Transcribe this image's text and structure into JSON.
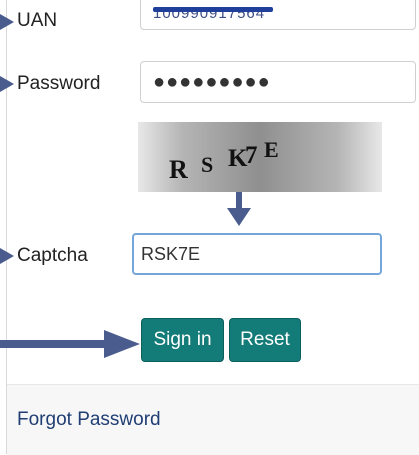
{
  "form": {
    "uan_label": "UAN",
    "uan_value": "100990917564",
    "password_label": "Password",
    "password_value": "●●●●●●●●●",
    "captcha_label": "Captcha",
    "captcha_value": "RSK7E"
  },
  "captcha_image": {
    "chars": [
      "R",
      "S",
      "K",
      "7",
      "E"
    ]
  },
  "buttons": {
    "signin_label": "Sign in",
    "reset_label": "Reset"
  },
  "links": {
    "forgot_password": "Forgot Password"
  },
  "colors": {
    "button_bg": "#137b78",
    "annotation_arrow": "#4a5c8d",
    "captcha_border": "#74a6db",
    "link": "#203e74"
  },
  "icons": {
    "annotation": "arrow"
  }
}
